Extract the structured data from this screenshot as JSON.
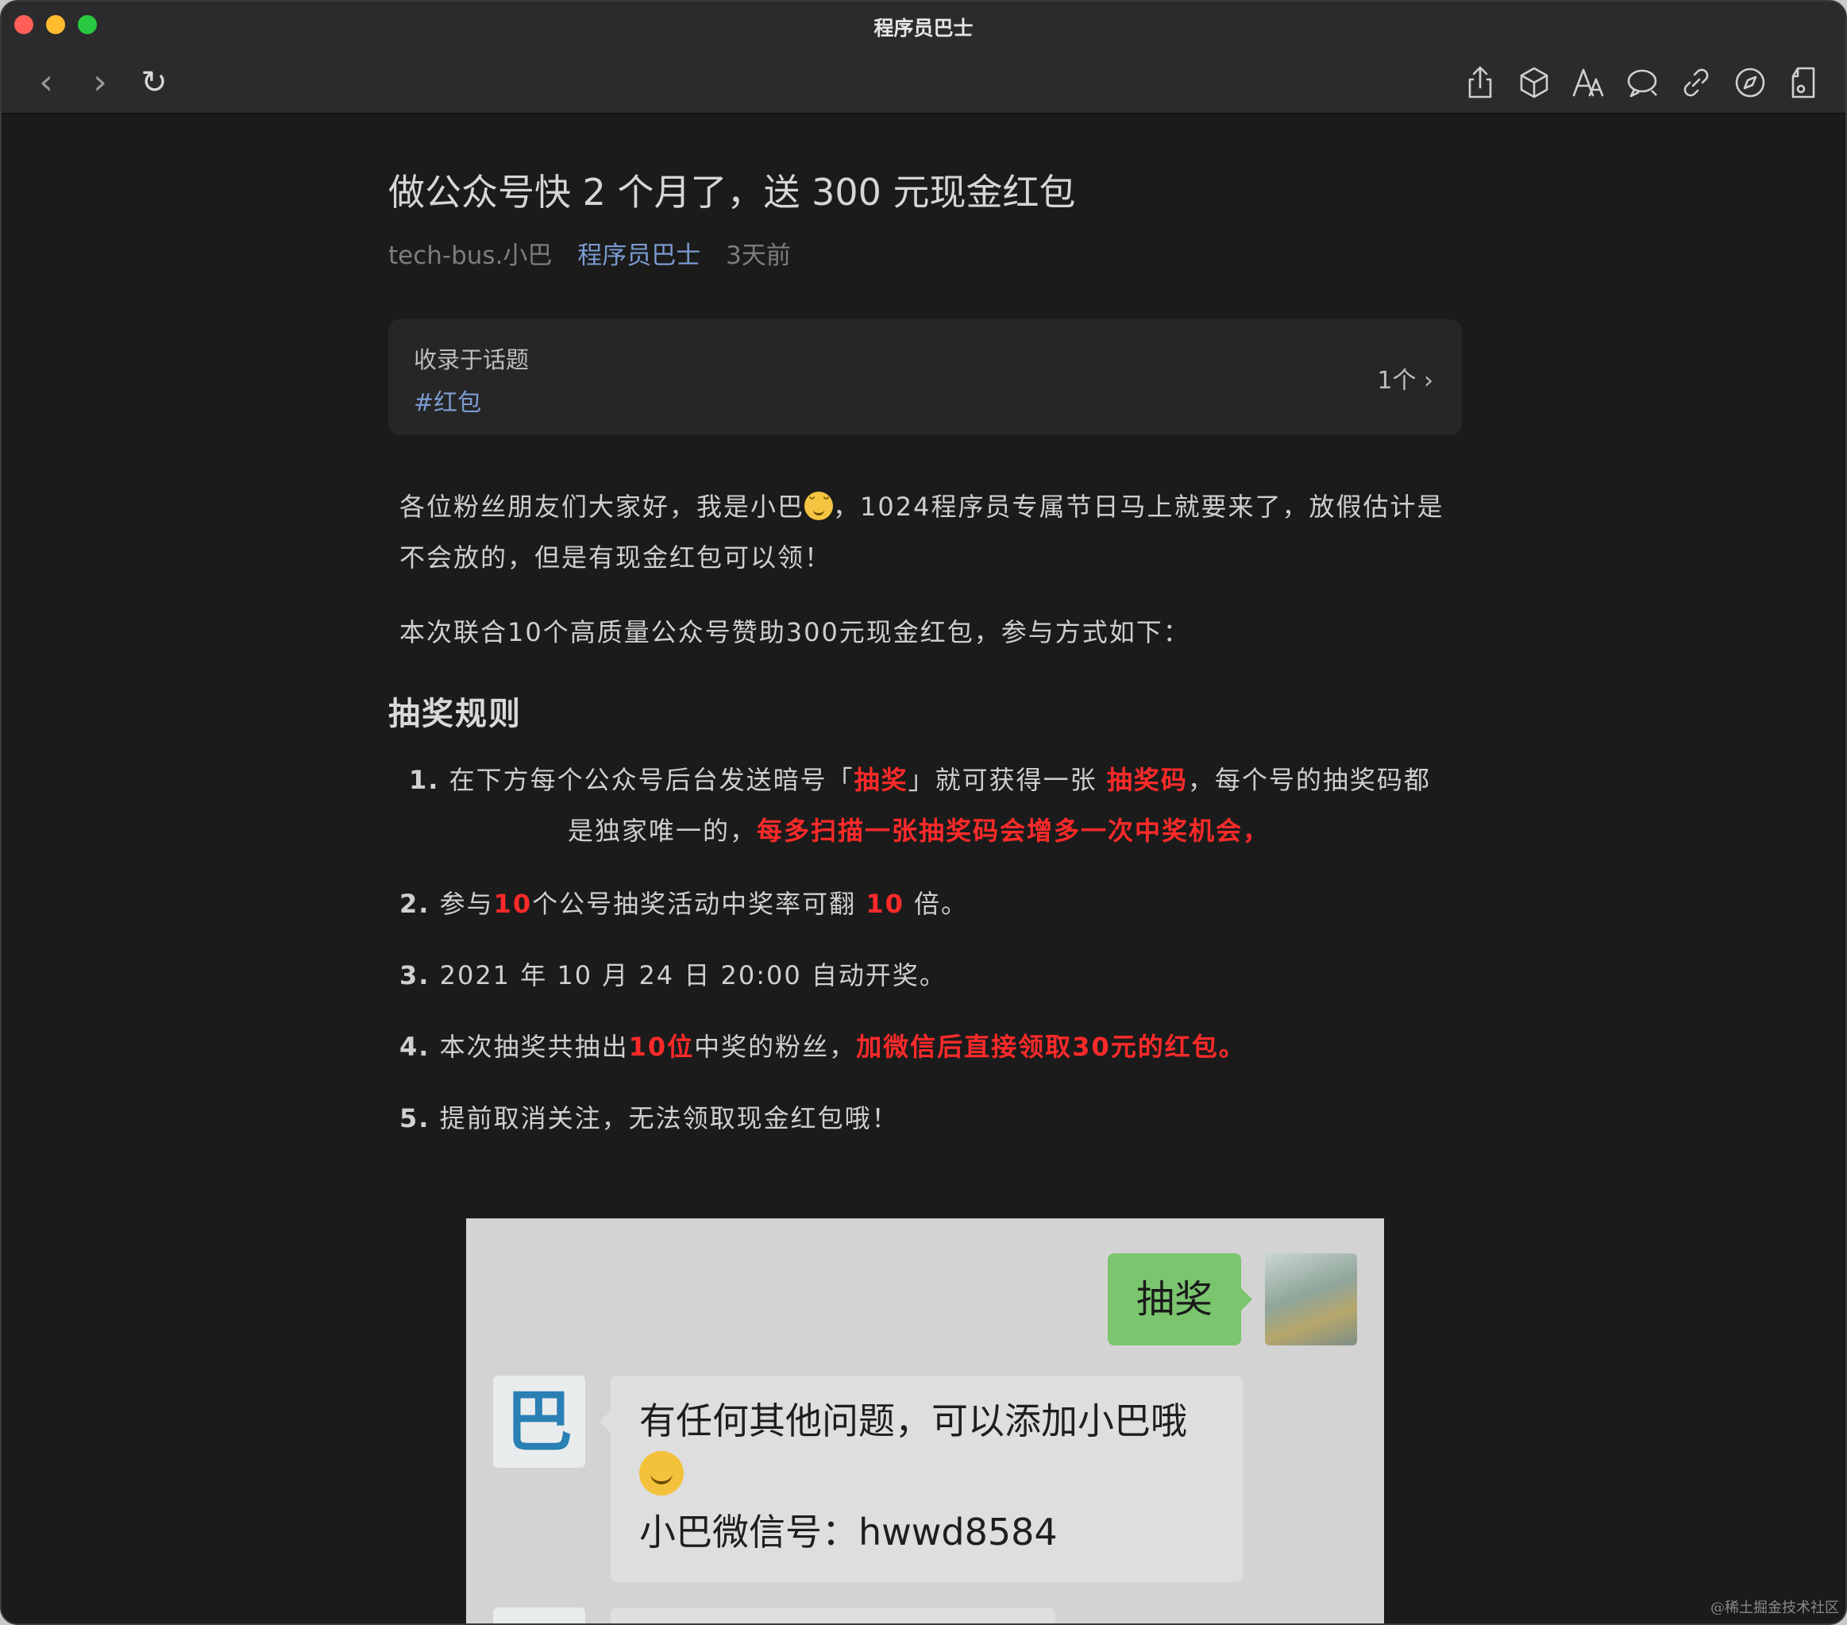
{
  "window": {
    "title": "程序员巴士"
  },
  "nav": {
    "back_glyph": "‹",
    "forward_glyph": "›",
    "reload_glyph": "↻"
  },
  "toolbar": {
    "icons": [
      "share-icon",
      "box-icon",
      "font-size-icon",
      "comment-icon",
      "link-icon",
      "compass-icon",
      "note-icon"
    ]
  },
  "article": {
    "title": "做公众号快 2 个月了，送 300 元现金红包",
    "author": "tech-bus.小巴",
    "account": "程序员巴士",
    "time": "3天前",
    "topic": {
      "label": "收录于话题",
      "tag": "#红包",
      "count": "1个 ›"
    },
    "p1_before": "各位粉丝朋友们大家好，我是小巴",
    "p1_after": "，1024程序员专属节日马上就要来了，放假估计是不会放的，但是有现金红包可以领！",
    "p2": "本次联合10个高质量公众号赞助300元现金红包，参与方式如下：",
    "h2": "抽奖规则",
    "rules": {
      "r1_num": "1.",
      "r1_a": " 在下方每个公众号后台发送暗号「",
      "r1_b": "抽奖",
      "r1_c": "」就可获得一张 ",
      "r1_d": "抽奖码",
      "r1_e": "，每个号的抽奖码都",
      "r1_f": "是独家唯一的，",
      "r1_g": "每多扫描一张抽奖码会增多一次中奖机会，",
      "r2_num": "2.",
      "r2_a": " 参与",
      "r2_b": "10",
      "r2_c": "个公号抽奖活动中奖率可翻 ",
      "r2_d": "10",
      "r2_e": " 倍。",
      "r3_num": "3.",
      "r3_a": " 2021 年 10 月 24 日 20:00 自动开奖。",
      "r4_num": "4.",
      "r4_a": " 本次抽奖共抽出",
      "r4_b": "10位",
      "r4_c": "中奖的粉丝，",
      "r4_d": "加微信后直接领取30元的红包。",
      "r5_num": "5.",
      "r5_a": " 提前取消关注，无法领取现金红包哦！"
    }
  },
  "chat": {
    "me_message": "抽奖",
    "bot_avatar_glyph": "巴",
    "bot_line1": "有任何其他问题，可以添加小巴哦",
    "bot_line3": "小巴微信号：hwwd8584"
  },
  "watermark": "@稀土掘金技术社区",
  "colors": {
    "accent_link": "#7b9bd1",
    "highlight_red": "#ff2a2a",
    "chat_green": "#7ac56d"
  }
}
